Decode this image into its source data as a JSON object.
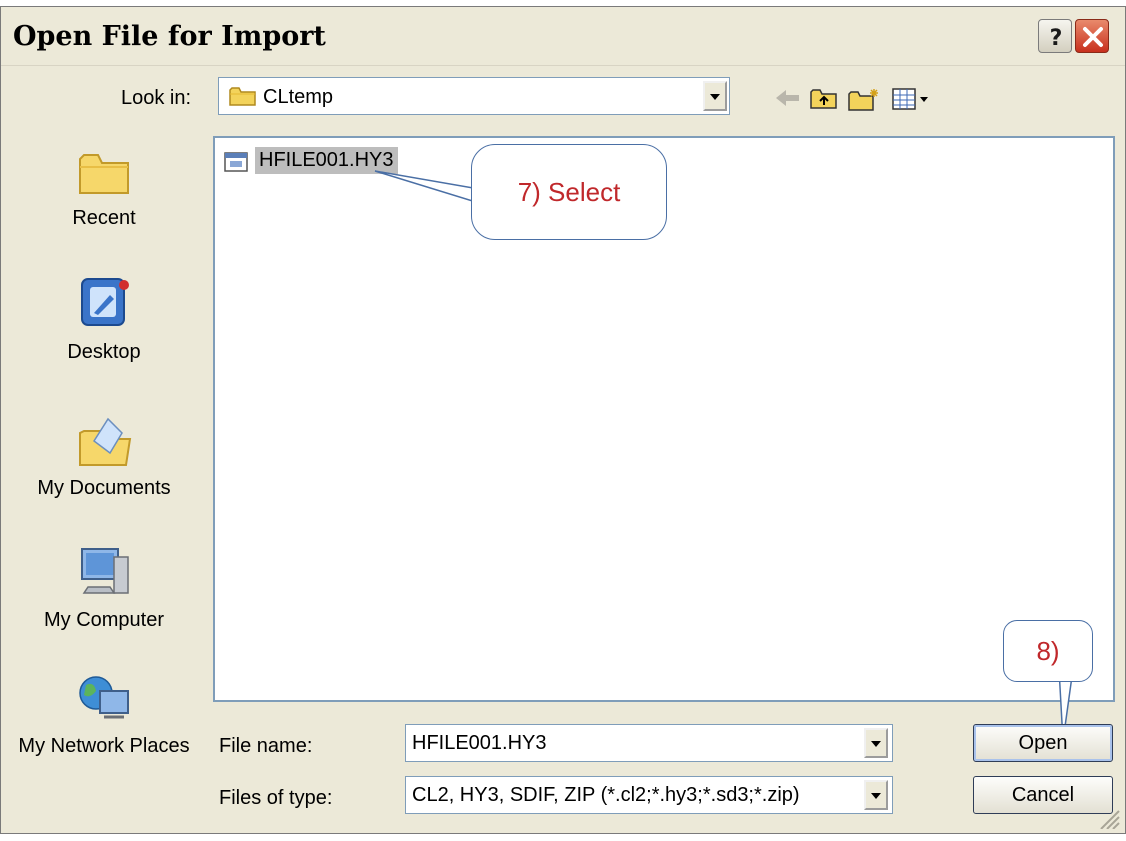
{
  "window": {
    "title": "Open File for Import"
  },
  "titlebar": {
    "help_label": "?",
    "close_label": "✕"
  },
  "lookin": {
    "label": "Look in:",
    "value": "CLtemp"
  },
  "toolbar": {
    "icons": [
      "back-arrow-icon",
      "up-folder-icon",
      "new-folder-icon",
      "view-menu-icon"
    ]
  },
  "places": [
    {
      "label": "Recent",
      "icon": "recent-folder-icon"
    },
    {
      "label": "Desktop",
      "icon": "desktop-icon"
    },
    {
      "label": "My Documents",
      "icon": "my-documents-icon"
    },
    {
      "label": "My Computer",
      "icon": "my-computer-icon"
    },
    {
      "label": "My Network Places",
      "icon": "network-places-icon"
    }
  ],
  "files": [
    {
      "name": "HFILE001.HY3",
      "icon": "hy3-file-icon",
      "selected": true
    }
  ],
  "annotations": {
    "select": "7) Select",
    "open": "8)"
  },
  "filename": {
    "label": "File name:",
    "value": "HFILE001.HY3"
  },
  "filetype": {
    "label": "Files of type:",
    "value": "CL2, HY3, SDIF, ZIP (*.cl2;*.hy3;*.sd3;*.zip)"
  },
  "buttons": {
    "open": "Open",
    "cancel": "Cancel"
  },
  "colors": {
    "dialog_bg": "#ece9d8",
    "annotation_text": "#c0282b",
    "annotation_border": "#4a6fa5",
    "selection": "#bdbdbd"
  }
}
